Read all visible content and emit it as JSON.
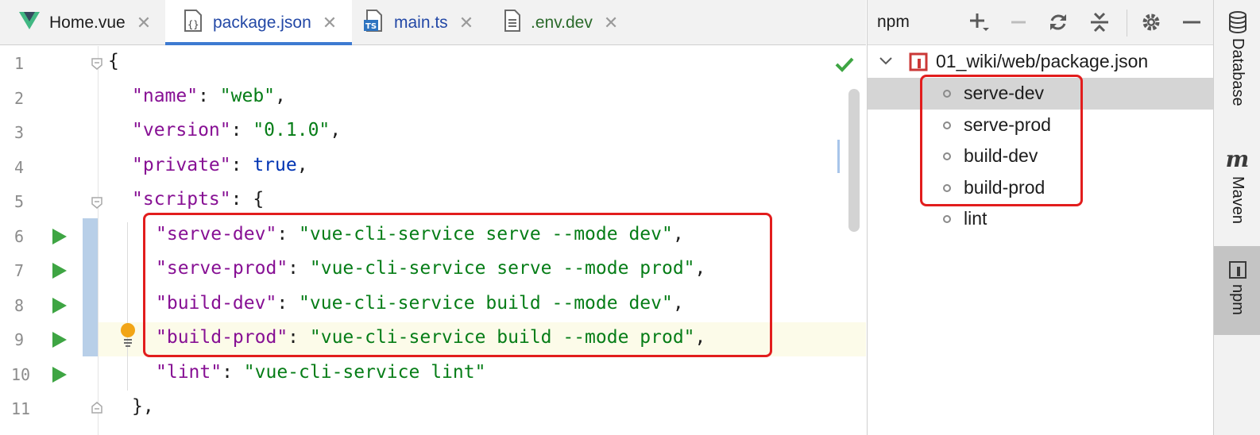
{
  "editor": {
    "tabs": [
      {
        "label": "Home.vue",
        "icon": "vue-file-icon"
      },
      {
        "label": "package.json",
        "icon": "json-file-icon",
        "active": true
      },
      {
        "label": "main.ts",
        "icon": "typescript-file-icon"
      },
      {
        "label": ".env.dev",
        "icon": "text-file-icon"
      }
    ],
    "tab_close": "✕",
    "line_numbers": [
      "1",
      "2",
      "3",
      "4",
      "5",
      "6",
      "7",
      "8",
      "9",
      "10",
      "11"
    ],
    "code": {
      "l1": "{",
      "l2_key": "\"name\"",
      "l2_val": "\"web\"",
      "l3_key": "\"version\"",
      "l3_val": "\"0.1.0\"",
      "l4_key": "\"private\"",
      "l4_val": "true",
      "l5_key": "\"scripts\"",
      "l5_tail": "{",
      "l6_key": "\"serve-dev\"",
      "l6_val": "\"vue-cli-service serve --mode dev\"",
      "l7_key": "\"serve-prod\"",
      "l7_val": "\"vue-cli-service serve --mode prod\"",
      "l8_key": "\"build-dev\"",
      "l8_val": "\"vue-cli-service build --mode dev\"",
      "l9_key": "\"build-prod\"",
      "l9_val": "\"vue-cli-service build --mode prod\"",
      "l10_key": "\"lint\"",
      "l10_val": "\"vue-cli-service lint\"",
      "l11": "},"
    },
    "colors": {
      "key": "#871094",
      "string": "#067d17",
      "keyword": "#0033b3",
      "run": "#3ea543",
      "highlight": "#e21d1d"
    }
  },
  "npm_panel": {
    "title": "npm",
    "toolbar": [
      "add-icon",
      "remove-icon",
      "refresh-icon",
      "collapse-icon",
      "settings-icon",
      "minimize-icon"
    ],
    "root": "01_wiki/web/package.json",
    "scripts": [
      "serve-dev",
      "serve-prod",
      "build-dev",
      "build-prod",
      "lint"
    ],
    "selected": "serve-dev"
  },
  "side_strip": {
    "items": [
      "Database",
      "Maven",
      "npm"
    ],
    "maven_glyph": "m",
    "active": "npm"
  }
}
